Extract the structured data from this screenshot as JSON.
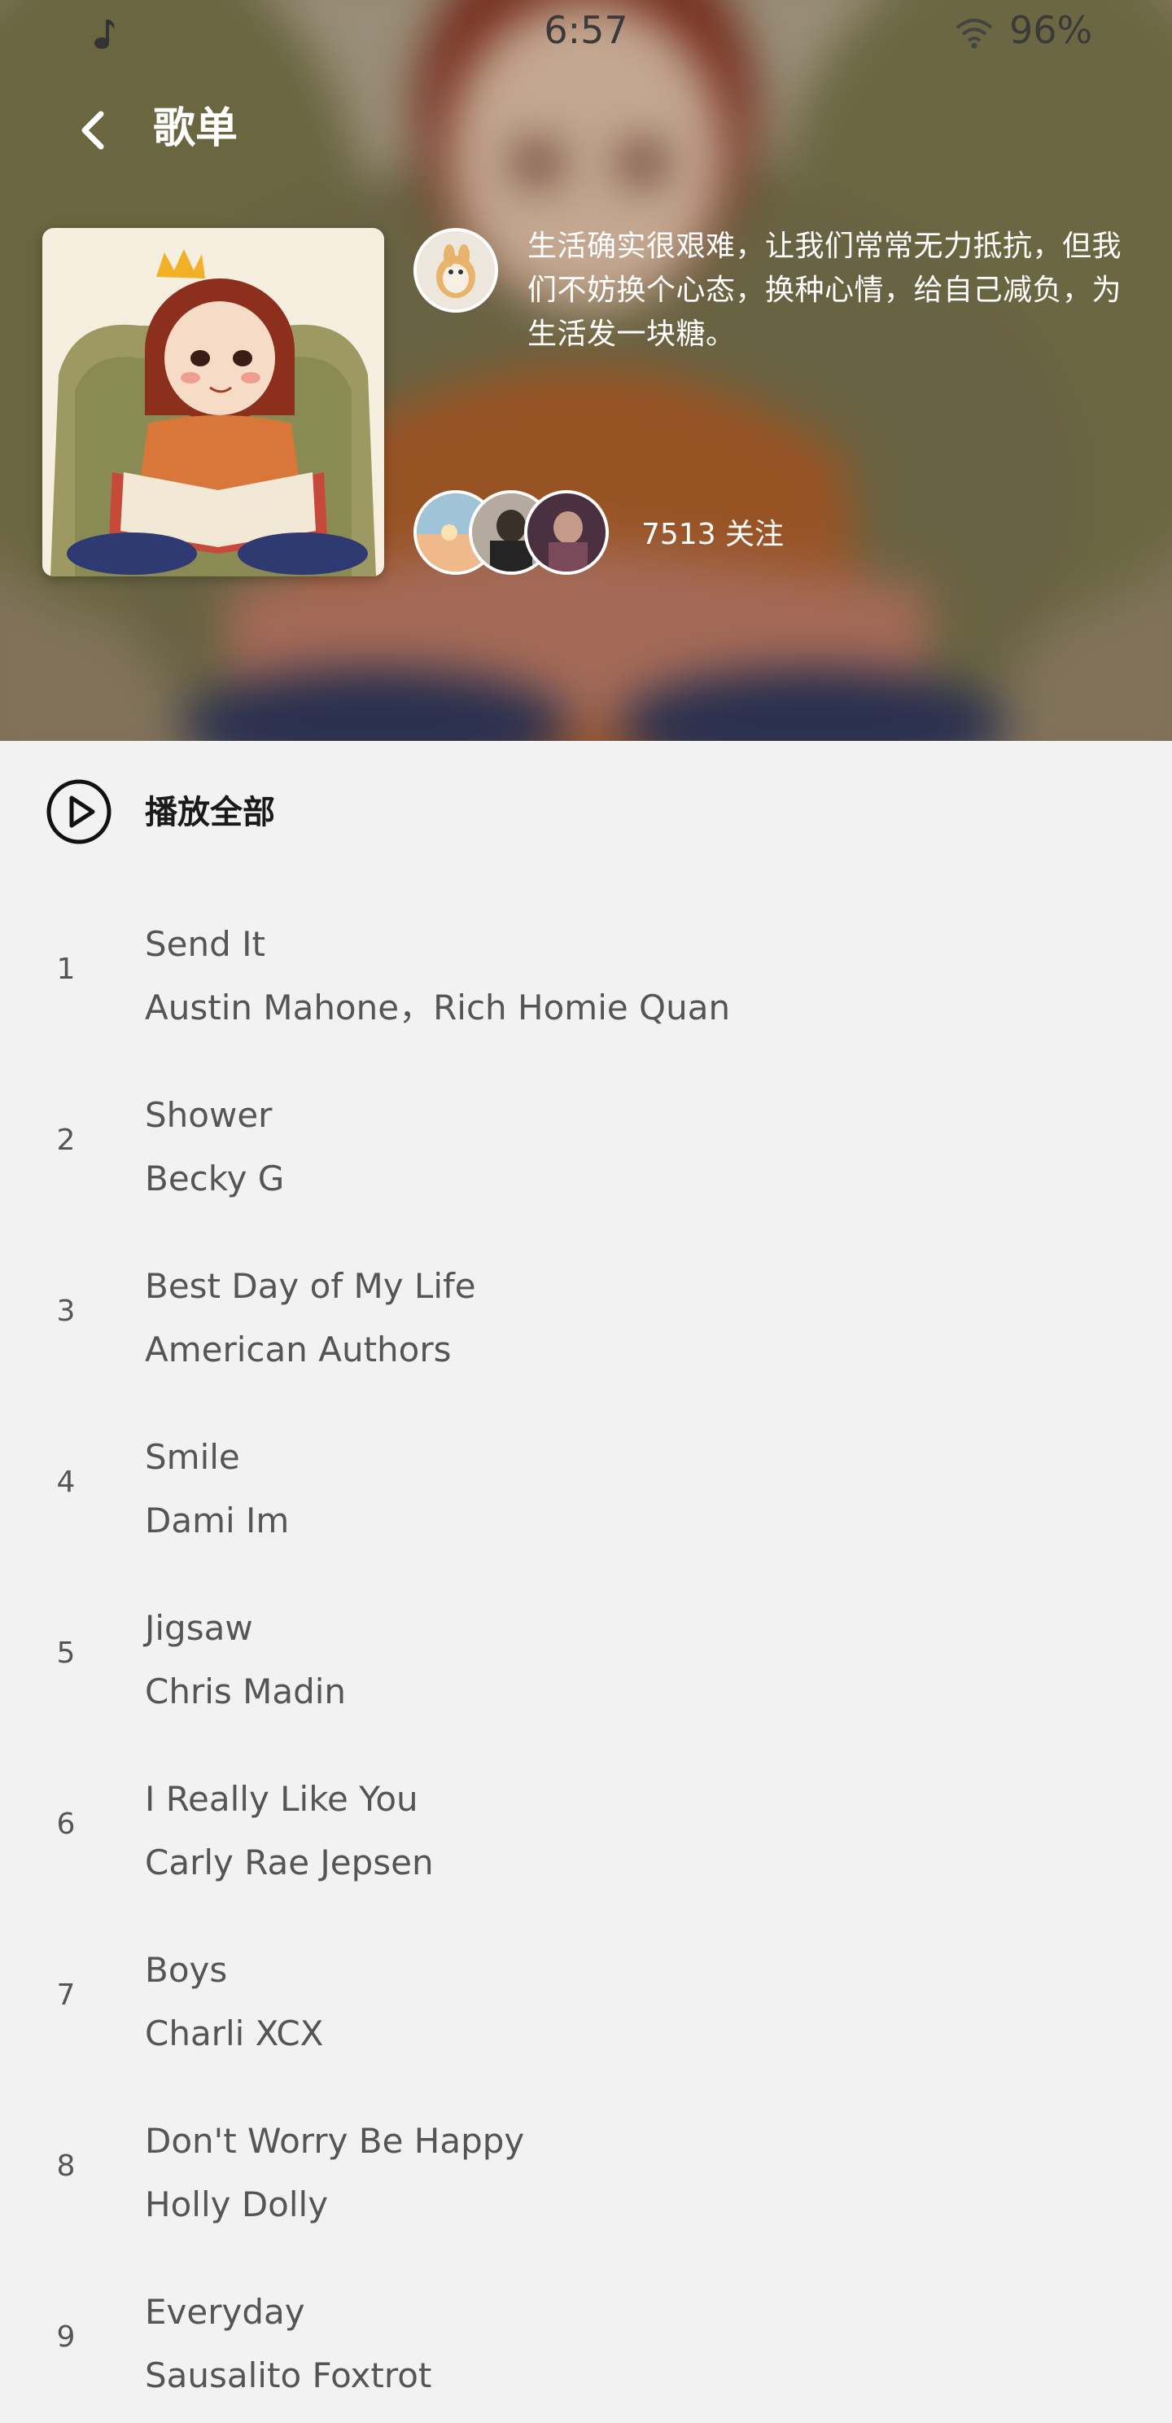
{
  "status_bar": {
    "time": "6:57",
    "battery": "96%",
    "icons": [
      "music-note-icon",
      "wifi-icon"
    ]
  },
  "header": {
    "title": "歌单",
    "back_icon": "chevron-left-icon"
  },
  "playlist": {
    "description": "生活确实很艰难，让我们常常无力抵抗，但我们不妨换个心态，换种心情，给自己减负，为生活发一块糖。",
    "follow_count": "7513 关注"
  },
  "play_all": {
    "label": "播放全部",
    "icon": "play-circle-icon"
  },
  "songs": [
    {
      "index": "1",
      "title": "Send It",
      "artist": "Austin Mahone，Rich Homie Quan"
    },
    {
      "index": "2",
      "title": "Shower",
      "artist": "Becky G"
    },
    {
      "index": "3",
      "title": "Best Day of My Life",
      "artist": "American Authors"
    },
    {
      "index": "4",
      "title": "Smile",
      "artist": "Dami Im"
    },
    {
      "index": "5",
      "title": "Jigsaw",
      "artist": "Chris Madin"
    },
    {
      "index": "6",
      "title": "I Really Like You",
      "artist": "Carly Rae Jepsen"
    },
    {
      "index": "7",
      "title": "Boys",
      "artist": "Charli XCX"
    },
    {
      "index": "8",
      "title": "Don't Worry Be Happy",
      "artist": "Holly Dolly"
    },
    {
      "index": "9",
      "title": "Everyday",
      "artist": "Sausalito Foxtrot"
    }
  ],
  "colors": {
    "list_background": "#f2f2f2",
    "header_text": "#ffffff",
    "song_text": "#555555"
  }
}
